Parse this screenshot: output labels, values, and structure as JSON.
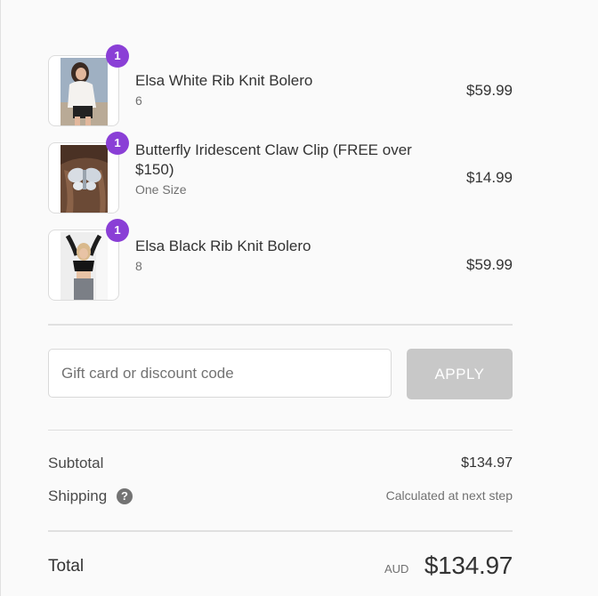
{
  "products": [
    {
      "title": "Elsa White Rib Knit Bolero",
      "variant": "6",
      "price": "$59.99",
      "quantity": "1",
      "image_icon": "product-photo-woman-white-bolero"
    },
    {
      "title": "Butterfly Iridescent Claw Clip (FREE over $150)",
      "variant": "One Size",
      "price": "$14.99",
      "quantity": "1",
      "image_icon": "product-photo-butterfly-clip"
    },
    {
      "title": "Elsa Black Rib Knit Bolero",
      "variant": "8",
      "price": "$59.99",
      "quantity": "1",
      "image_icon": "product-photo-woman-black-bolero"
    }
  ],
  "discount": {
    "placeholder": "Gift card or discount code",
    "value": "",
    "apply_label": "APPLY"
  },
  "totals": {
    "subtotal_label": "Subtotal",
    "subtotal_value": "$134.97",
    "shipping_label": "Shipping",
    "shipping_help_icon": "question-mark-icon",
    "shipping_value": "Calculated at next step",
    "total_label": "Total",
    "currency": "AUD",
    "total_value": "$134.97"
  },
  "colors": {
    "badge": "#8a3fd6",
    "apply_button_disabled": "#c8c8c8",
    "background": "#fafafa"
  }
}
